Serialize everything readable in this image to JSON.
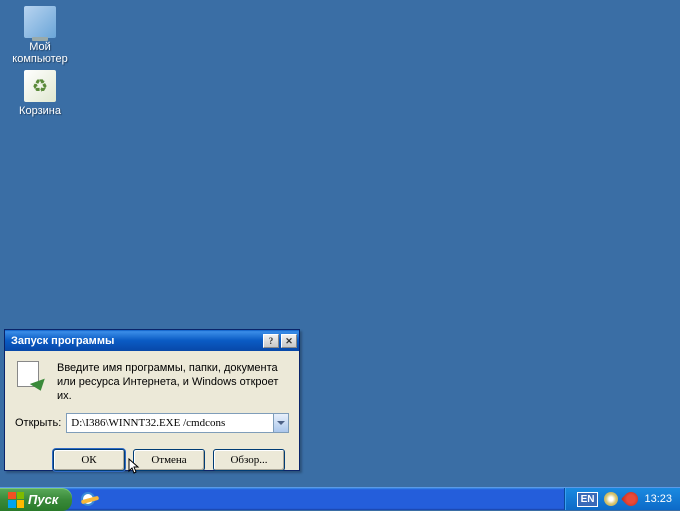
{
  "desktop": {
    "icons": [
      {
        "name": "my-computer",
        "label": "Мой\nкомпьютер"
      },
      {
        "name": "recycle-bin",
        "label": "Корзина"
      }
    ]
  },
  "dialog": {
    "title": "Запуск программы",
    "description": "Введите имя программы, папки, документа или ресурса Интернета, и Windows откроет их.",
    "open_label": "Открыть:",
    "open_value": "D:\\I386\\WINNT32.EXE /cmdcons",
    "buttons": {
      "ok": "ОК",
      "cancel": "Отмена",
      "browse": "Обзор..."
    }
  },
  "taskbar": {
    "start": "Пуск",
    "lang": "EN",
    "clock": "13:23"
  }
}
